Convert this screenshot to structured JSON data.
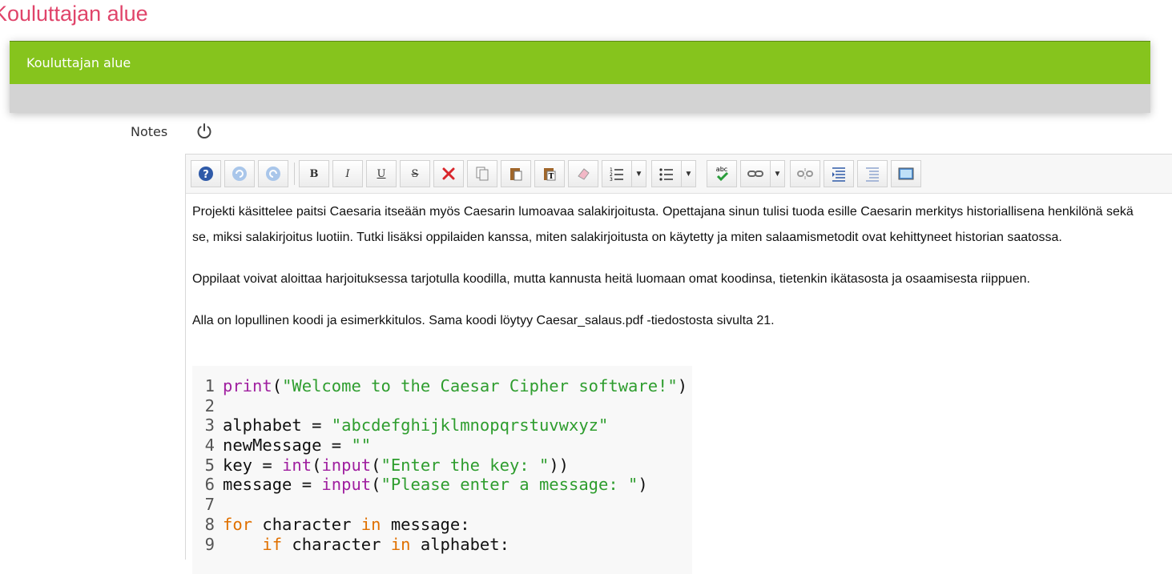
{
  "page": {
    "heading": "Kouluttajan alue"
  },
  "panel": {
    "title": "Kouluttajan alue"
  },
  "notes": {
    "label": "Notes",
    "power_icon": "power-icon"
  },
  "toolbar": {
    "buttons": [
      {
        "name": "help",
        "icon": "help-icon"
      },
      {
        "name": "undo",
        "icon": "undo-icon"
      },
      {
        "name": "redo",
        "icon": "redo-icon"
      },
      {
        "name": "bold",
        "label": "B"
      },
      {
        "name": "italic",
        "label": "I"
      },
      {
        "name": "underline",
        "label": "U"
      },
      {
        "name": "strikethrough",
        "label": "S"
      },
      {
        "name": "cut",
        "icon": "scissors-icon"
      },
      {
        "name": "copy",
        "icon": "copy-icon"
      },
      {
        "name": "paste",
        "icon": "paste-icon"
      },
      {
        "name": "paste-text",
        "icon": "paste-text-icon"
      },
      {
        "name": "remove-format",
        "icon": "eraser-icon"
      },
      {
        "name": "numbered-list",
        "icon": "numbered-list-icon"
      },
      {
        "name": "bullet-list",
        "icon": "bullet-list-icon"
      },
      {
        "name": "spellcheck",
        "label": "abc"
      },
      {
        "name": "link",
        "icon": "link-icon"
      },
      {
        "name": "unlink",
        "icon": "unlink-icon"
      },
      {
        "name": "indent",
        "icon": "indent-icon"
      },
      {
        "name": "outdent",
        "icon": "outdent-icon"
      },
      {
        "name": "image",
        "icon": "image-icon"
      }
    ]
  },
  "content": {
    "paragraph1": "Projekti käsittelee paitsi Caesaria itseään myös Caesarin lumoavaa salakirjoitusta. Opettajana sinun tulisi tuoda esille Caesarin merkitys historiallisena henkilönä sekä se, miksi salakirjoitus luotiin. Tutki lisäksi oppilaiden kanssa, miten salakirjoitusta on käytetty ja miten salaamismetodit ovat kehittyneet historian saatossa.",
    "paragraph2": "Oppilaat voivat aloittaa harjoituksessa tarjotulla koodilla, mutta kannusta heitä luomaan omat koodinsa, tietenkin ikätasosta ja osaamisesta riippuen.",
    "paragraph3": "Alla on lopullinen koodi ja esimerkkitulos. Sama koodi löytyy Caesar_salaus.pdf -tiedostosta sivulta 21."
  },
  "code": {
    "lines": [
      {
        "n": "1",
        "parts": [
          [
            "print",
            "p"
          ],
          [
            "(",
            ""
          ],
          [
            "\"Welcome to the Caesar Cipher software!\"",
            "s"
          ],
          [
            ")",
            ""
          ]
        ]
      },
      {
        "n": "2",
        "parts": []
      },
      {
        "n": "3",
        "parts": [
          [
            "alphabet = ",
            ""
          ],
          [
            "\"abcdefghijklmnopqrstuvwxyz\"",
            "s"
          ]
        ]
      },
      {
        "n": "4",
        "parts": [
          [
            "newMessage = ",
            ""
          ],
          [
            "\"\"",
            "s"
          ]
        ]
      },
      {
        "n": "5",
        "parts": [
          [
            "key = ",
            ""
          ],
          [
            "int",
            "p"
          ],
          [
            "(",
            ""
          ],
          [
            "input",
            "p"
          ],
          [
            "(",
            ""
          ],
          [
            "\"Enter the key: \"",
            "s"
          ],
          [
            "))",
            ""
          ]
        ]
      },
      {
        "n": "6",
        "parts": [
          [
            "message = ",
            ""
          ],
          [
            "input",
            "p"
          ],
          [
            "(",
            ""
          ],
          [
            "\"Please enter a message: \"",
            "s"
          ],
          [
            ")",
            ""
          ]
        ]
      },
      {
        "n": "7",
        "parts": []
      },
      {
        "n": "8",
        "parts": [
          [
            "for",
            "o"
          ],
          [
            " character ",
            ""
          ],
          [
            "in",
            "o"
          ],
          [
            " message:",
            ""
          ]
        ]
      },
      {
        "n": "9",
        "parts": [
          [
            "    ",
            ""
          ],
          [
            "if",
            "o"
          ],
          [
            " character ",
            ""
          ],
          [
            "in",
            "o"
          ],
          [
            " alphabet:",
            ""
          ]
        ]
      }
    ]
  },
  "colors": {
    "accent_green": "#86c41d",
    "heading_pink": "#e0446a",
    "keyword_purple": "#a020a0",
    "keyword_orange": "#e07000",
    "string_green": "#2e9d2e"
  }
}
